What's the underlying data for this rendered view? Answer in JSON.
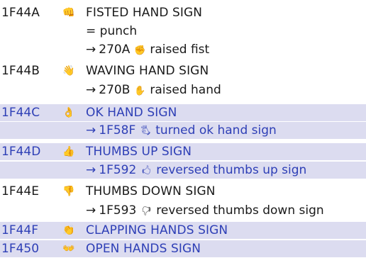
{
  "entries": [
    {
      "code": "1F44A",
      "glyph": "👊",
      "name": "FISTED HAND SIGN",
      "highlighted": false,
      "alias": "= punch",
      "xref": {
        "arrow": "→",
        "code": "270A",
        "glyph": "✊",
        "name": "raised fist"
      }
    },
    {
      "code": "1F44B",
      "glyph": "👋",
      "name": "WAVING HAND SIGN",
      "highlighted": false,
      "xref": {
        "arrow": "→",
        "code": "270B",
        "glyph": "✋",
        "name": "raised hand"
      }
    },
    {
      "code": "1F44C",
      "glyph": "👌",
      "name": "OK HAND SIGN",
      "highlighted": true,
      "xref": {
        "arrow": "→",
        "code": "1F58F",
        "glyph": "🖏",
        "name": "turned ok hand sign"
      }
    },
    {
      "code": "1F44D",
      "glyph": "👍",
      "name": "THUMBS UP SIGN",
      "highlighted": true,
      "xref": {
        "arrow": "→",
        "code": "1F592",
        "glyph": "🖒",
        "name": "reversed thumbs up sign"
      }
    },
    {
      "code": "1F44E",
      "glyph": "👎",
      "name": "THUMBS DOWN SIGN",
      "highlighted": false,
      "xref": {
        "arrow": "→",
        "code": "1F593",
        "glyph": "🖓",
        "name": "reversed thumbs down sign"
      }
    },
    {
      "code": "1F44F",
      "glyph": "👏",
      "name": "CLAPPING HANDS SIGN",
      "highlighted": true
    },
    {
      "code": "1F450",
      "glyph": "👐",
      "name": "OPEN HANDS SIGN",
      "highlighted": true
    }
  ],
  "colors": {
    "highlight_bg": "#dcdcf0",
    "highlight_text": "#2e3fb6",
    "normal_text": "#1a1a1a"
  }
}
